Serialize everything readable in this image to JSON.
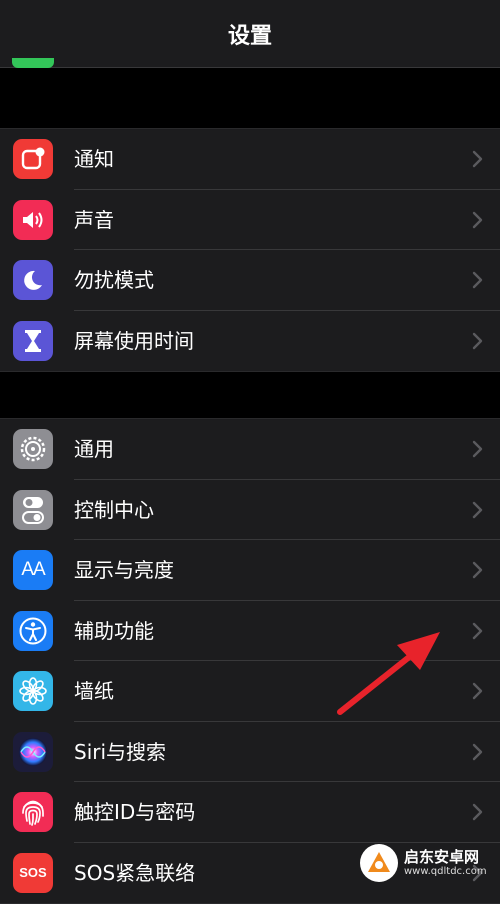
{
  "header": {
    "title": "设置"
  },
  "group1": {
    "items": [
      {
        "label": "通知",
        "icon": "notifications-icon",
        "color": "#f03a36"
      },
      {
        "label": "声音",
        "icon": "sound-icon",
        "color": "#f22c55"
      },
      {
        "label": "勿扰模式",
        "icon": "moon-icon",
        "color": "#5b55d6"
      },
      {
        "label": "屏幕使用时间",
        "icon": "hourglass-icon",
        "color": "#5b55d6"
      }
    ]
  },
  "group2": {
    "items": [
      {
        "label": "通用",
        "icon": "gear-icon",
        "color": "#8e8e93"
      },
      {
        "label": "控制中心",
        "icon": "toggles-icon",
        "color": "#8e8e93"
      },
      {
        "label": "显示与亮度",
        "icon": "text-size-icon",
        "color": "#1a7cf5"
      },
      {
        "label": "辅助功能",
        "icon": "accessibility-icon",
        "color": "#1a7cf5"
      },
      {
        "label": "墙纸",
        "icon": "flower-icon",
        "color": "#33b6e8"
      },
      {
        "label": "Siri与搜索",
        "icon": "siri-icon",
        "color": "#1c1c3a"
      },
      {
        "label": "触控ID与密码",
        "icon": "fingerprint-icon",
        "color": "#f22c55"
      },
      {
        "label": "SOS紧急联络",
        "icon": "sos-icon",
        "color": "#f03a36"
      }
    ]
  },
  "icon_texts": {
    "display": "AA",
    "sos": "SOS"
  },
  "watermark": {
    "name": "启东安卓网",
    "url": "www.qdltdc.com"
  },
  "colors": {
    "background": "#000000",
    "cell": "#1c1c1e",
    "separator": "#38383a",
    "chevron": "#5a5a5e",
    "arrow": "#e8232b"
  }
}
